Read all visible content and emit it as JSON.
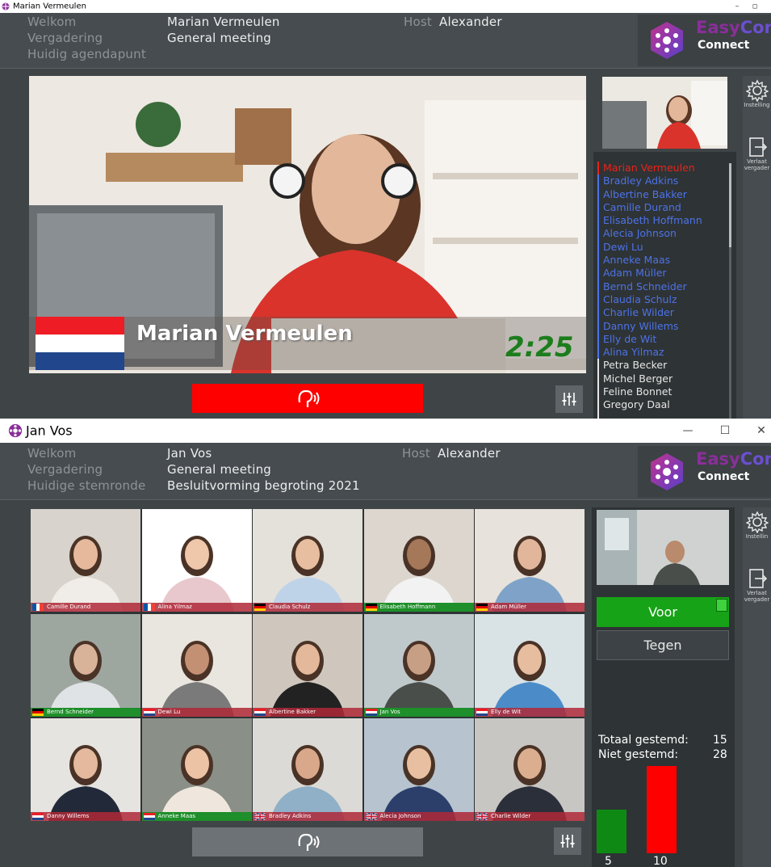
{
  "window1": {
    "title": "Marian Vermeulen",
    "controls": {
      "minimize": "–",
      "restore": "▫"
    },
    "header": {
      "labels": {
        "welcome": "Welkom",
        "meeting": "Vergadering",
        "agenda": "Huidig agendapunt"
      },
      "values": {
        "user": "Marian Vermeulen",
        "meeting": "General meeting",
        "agenda": ""
      },
      "host_label": "Host",
      "host_name": "Alexander"
    },
    "speaker": {
      "name": "Marian Vermeulen",
      "timer": "2:25",
      "flag": "NL"
    },
    "participants": [
      {
        "name": "Marian Vermeulen",
        "status": "speaking"
      },
      {
        "name": "Bradley Adkins",
        "status": "present"
      },
      {
        "name": "Albertine Bakker",
        "status": "present"
      },
      {
        "name": "Camille Durand",
        "status": "present"
      },
      {
        "name": "Elisabeth Hoffmann",
        "status": "present"
      },
      {
        "name": "Alecia Johnson",
        "status": "present"
      },
      {
        "name": "Dewi Lu",
        "status": "present"
      },
      {
        "name": "Anneke Maas",
        "status": "present"
      },
      {
        "name": "Adam Müller",
        "status": "present"
      },
      {
        "name": "Bernd Schneider",
        "status": "present"
      },
      {
        "name": "Claudia Schulz",
        "status": "present"
      },
      {
        "name": "Charlie Wilder",
        "status": "present"
      },
      {
        "name": "Danny Willems",
        "status": "present"
      },
      {
        "name": "Elly de Wit",
        "status": "present"
      },
      {
        "name": "Alina Yilmaz",
        "status": "present"
      },
      {
        "name": "Petra Becker",
        "status": "absent"
      },
      {
        "name": "Michel Berger",
        "status": "absent"
      },
      {
        "name": "Feline Bonnet",
        "status": "absent"
      },
      {
        "name": "Gregory Daal",
        "status": "absent"
      }
    ],
    "sidebar": {
      "settings": "Instelling",
      "leave_1": "Verlaat",
      "leave_2": "vergader"
    },
    "mic_icon": "request-to-speak-icon",
    "mic_state": "active"
  },
  "window2": {
    "title": "Jan Vos",
    "controls": {
      "minimize": "—",
      "maximize": "☐",
      "close": "✕"
    },
    "header": {
      "labels": {
        "welcome": "Welkom",
        "meeting": "Vergadering",
        "voting": "Huidige stemronde"
      },
      "values": {
        "user": "Jan Vos",
        "meeting": "General meeting",
        "voting": "Besluitvorming begroting 2021"
      },
      "host_label": "Host",
      "host_name": "Alexander"
    },
    "tiles": [
      {
        "name": "Camille Durand",
        "flag": "FR",
        "vote": "none"
      },
      {
        "name": "Alina Yilmaz",
        "flag": "FR",
        "vote": "none"
      },
      {
        "name": "Claudia Schulz",
        "flag": "DE",
        "vote": "none"
      },
      {
        "name": "Elisabeth Hoffmann",
        "flag": "DE",
        "vote": "for"
      },
      {
        "name": "Adam Müller",
        "flag": "DE",
        "vote": "none"
      },
      {
        "name": "Bernd Schneider",
        "flag": "DE",
        "vote": "for"
      },
      {
        "name": "Dewi Lu",
        "flag": "NL",
        "vote": "none"
      },
      {
        "name": "Albertine Bakker",
        "flag": "NL",
        "vote": "none"
      },
      {
        "name": "Jan Vos",
        "flag": "NL",
        "vote": "for"
      },
      {
        "name": "Elly de Wit",
        "flag": "NL",
        "vote": "none"
      },
      {
        "name": "Danny Willems",
        "flag": "NL",
        "vote": "none"
      },
      {
        "name": "Anneke Maas",
        "flag": "NL",
        "vote": "for"
      },
      {
        "name": "Bradley Adkins",
        "flag": "UK",
        "vote": "none"
      },
      {
        "name": "Alecia Johnson",
        "flag": "UK",
        "vote": "none"
      },
      {
        "name": "Charlie Wilder",
        "flag": "UK",
        "vote": "none"
      }
    ],
    "voting": {
      "for_label": "Voor",
      "against_label": "Tegen",
      "selected": "for",
      "total_label": "Totaal gestemd:",
      "total_value": "15",
      "not_label": "Niet gestemd:",
      "not_value": "28",
      "bar_for_value": "5",
      "bar_against_value": "10"
    },
    "sidebar": {
      "settings": "Instellin",
      "leave_1": "Verlaat",
      "leave_2": "vergader"
    },
    "mic_icon": "request-to-speak-icon",
    "mic_state": "inactive"
  },
  "logo": {
    "part1": "Easy",
    "part2": "Conf",
    "line2": "Connect"
  },
  "colors": {
    "app_bg": "#3f4547",
    "header_bg": "#464c4f",
    "speaking": "#e8241c",
    "present": "#4d73e8",
    "absent": "#e6e6e6",
    "vote_for": "#17a317",
    "vote_against": "#ff0000",
    "mic_active": "#ff0000"
  },
  "chart_data": {
    "type": "bar",
    "categories": [
      "Voor",
      "Tegen"
    ],
    "values": [
      5,
      10
    ],
    "colors": [
      "#0e8a14",
      "#ff0000"
    ]
  }
}
